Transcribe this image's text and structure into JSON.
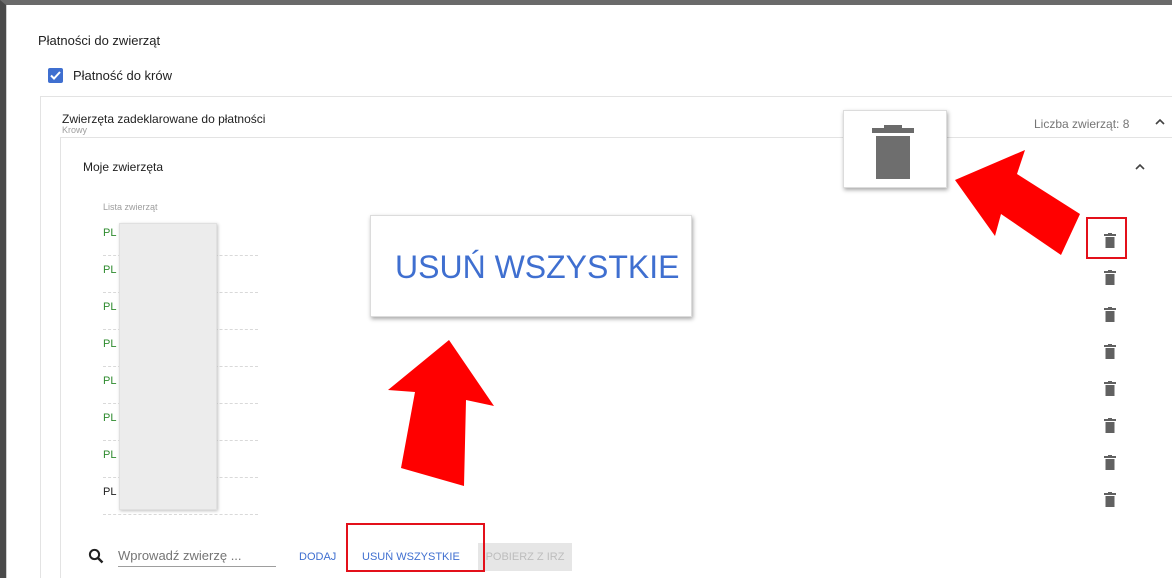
{
  "section": {
    "title": "Płatności do zwierząt"
  },
  "payment": {
    "checkbox_label": "Płatność do krów",
    "checked": true
  },
  "declared": {
    "title": "Zwierzęta zadeklarowane do płatności",
    "subtitle": "Krowy",
    "count_label": "Liczba zwierząt: 8"
  },
  "my_animals": {
    "title": "Moje zwierzęta",
    "list_label": "Lista zwierząt",
    "rows": [
      {
        "prefix": "PL"
      },
      {
        "prefix": "PL"
      },
      {
        "prefix": "PL"
      },
      {
        "prefix": "PL"
      },
      {
        "prefix": "PL"
      },
      {
        "prefix": "PL"
      },
      {
        "prefix": "PL"
      },
      {
        "prefix": "PL"
      }
    ]
  },
  "toolbar": {
    "search_placeholder": "Wprowadź zwierzę ...",
    "add_label": "DODAJ",
    "remove_all_label": "USUŃ WSZYSTKIE",
    "irz_label": "POBIERZ Z IRZ"
  },
  "callout": {
    "zoom_text": "USUŃ WSZYSTKIE"
  },
  "colors": {
    "accent": "#3f6fd0",
    "row_text_green": "#2e8b2e",
    "highlight_red": "#e3101a",
    "arrow_red": "#ff0000",
    "icon_gray": "#616161"
  },
  "icons": {
    "checkbox": "check-icon",
    "collapse": "chevron-up-icon",
    "row_delete": "trash-icon",
    "search": "search-icon"
  }
}
